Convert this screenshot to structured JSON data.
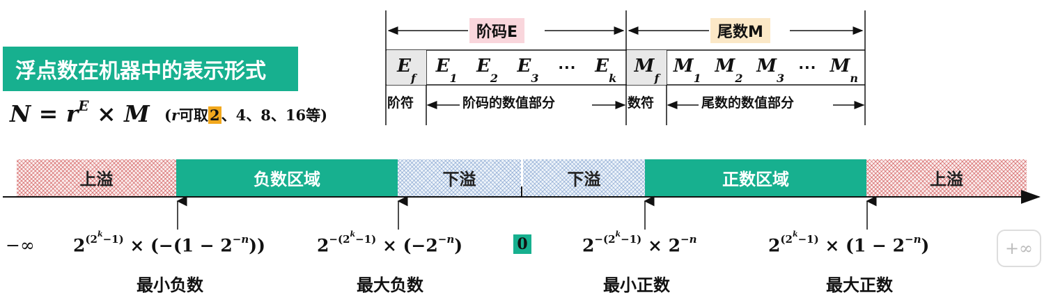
{
  "title": "浮点数在机器中的表示形式",
  "formula": {
    "N": "N",
    "eq": "=",
    "r": "r",
    "E": "E",
    "times": "×",
    "M": "M"
  },
  "note": {
    "open": "(",
    "r": "r",
    "text1": "可取",
    "highlight": "2",
    "text2": "、4、8、16等)"
  },
  "format": {
    "exponent_label": "阶码E",
    "mantissa_label": "尾数M",
    "exponent_sign": {
      "base": "E",
      "sub": "f"
    },
    "exponent_digits": [
      {
        "base": "E",
        "sub": "1"
      },
      {
        "base": "E",
        "sub": "2"
      },
      {
        "base": "E",
        "sub": "3"
      },
      {
        "base": "⋯",
        "sub": ""
      },
      {
        "base": "E",
        "sub": "k"
      }
    ],
    "mantissa_sign": {
      "base": "M",
      "sub": "f"
    },
    "mantissa_digits": [
      {
        "base": "M",
        "sub": "1"
      },
      {
        "base": "M",
        "sub": "2"
      },
      {
        "base": "M",
        "sub": "3"
      },
      {
        "base": "⋯",
        "sub": ""
      },
      {
        "base": "M",
        "sub": "n"
      }
    ],
    "exp_sign_label": "阶符",
    "exp_value_label": "阶码的数值部分",
    "man_sign_label": "数符",
    "man_value_label": "尾数的数值部分"
  },
  "number_line": {
    "regions": [
      "上溢",
      "负数区域",
      "下溢",
      "下溢",
      "正数区域",
      "上溢"
    ],
    "neg_inf": "−∞",
    "pos_inf": "+∞",
    "zero": "0",
    "labels": [
      "最小负数",
      "最大负数",
      "最小正数",
      "最大正数"
    ]
  },
  "colors": {
    "teal": "#17b08f",
    "pink_tag": "#f9d6dc",
    "yellow_tag": "#fbe8c7",
    "highlight": "#f2a81d"
  }
}
